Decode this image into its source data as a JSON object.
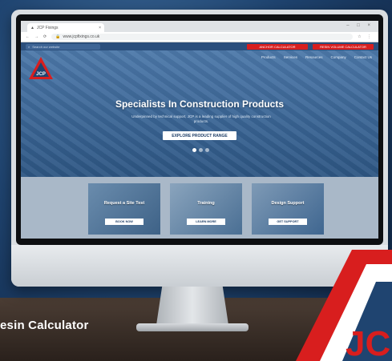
{
  "browser": {
    "tab_title": "JCP Fixings",
    "url": "www.jcpfixings.co.uk"
  },
  "site": {
    "search_placeholder": "Search our website",
    "top_buttons": [
      "ANCHOR CALCULATOR",
      "RESIN VOLUME CALCULATOR"
    ],
    "nav": [
      "Products",
      "Services",
      "Resources",
      "Company",
      "Contact Us"
    ],
    "hero_title": "Specialists In Construction Products",
    "hero_sub": "Underpinned by technical support, JCP is a leading supplier of high quality construction products.",
    "hero_cta": "EXPLORE PRODUCT RANGE",
    "cards": [
      {
        "title": "Request a Site Test",
        "button": "BOOK NOW"
      },
      {
        "title": "Training",
        "button": "LEARN MORE"
      },
      {
        "title": "Design Support",
        "button": "GET SUPPORT"
      }
    ],
    "logo_text": "JCP"
  },
  "caption": "esin Calculator",
  "brand_mark": "JC",
  "colors": {
    "brand_red": "#d81e1e",
    "brand_blue": "#1f4470"
  }
}
